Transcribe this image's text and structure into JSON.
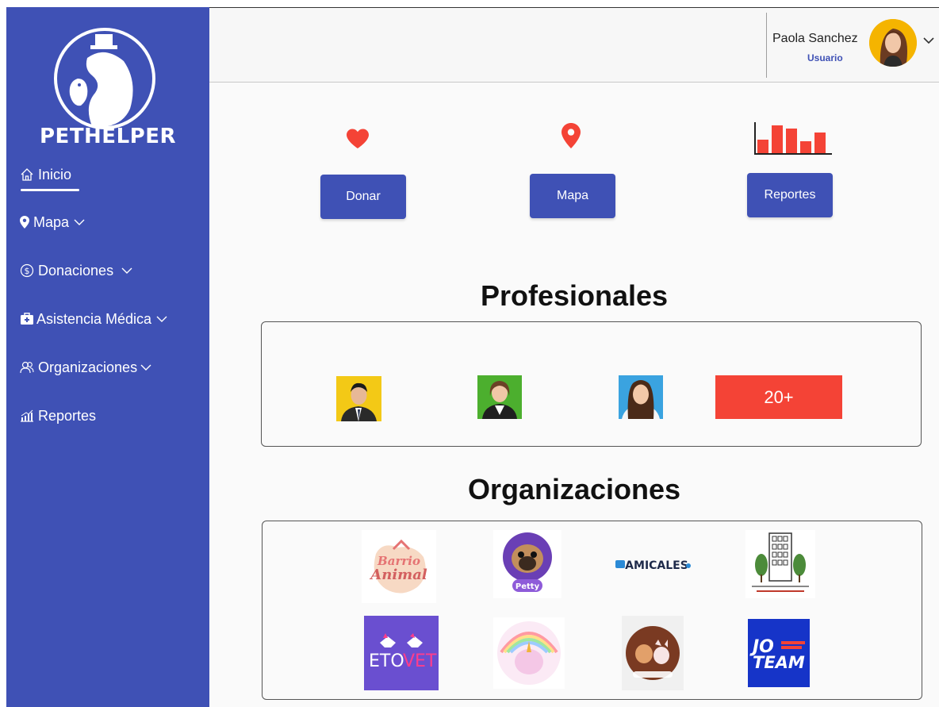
{
  "brand": {
    "name": "PETHELPER"
  },
  "sidebar": {
    "items": [
      {
        "label": "Inicio",
        "icon": "home-icon",
        "has_chevron": false,
        "active": true
      },
      {
        "label": "Mapa",
        "icon": "map-pin-icon",
        "has_chevron": true
      },
      {
        "label": "Donaciones",
        "icon": "coin-icon",
        "has_chevron": true
      },
      {
        "label": "Asistencia Médica",
        "icon": "medical-kit-icon",
        "has_chevron": true
      },
      {
        "label": "Organizaciones",
        "icon": "people-icon",
        "has_chevron": true
      },
      {
        "label": "Reportes",
        "icon": "bar-chart-icon",
        "has_chevron": false
      }
    ]
  },
  "header": {
    "user_name": "Paola Sanchez",
    "user_role": "Usuario"
  },
  "actions": [
    {
      "label": "Donar",
      "icon": "heart-icon"
    },
    {
      "label": "Mapa",
      "icon": "map-pin-icon"
    },
    {
      "label": "Reportes",
      "icon": "bar-chart-icon"
    }
  ],
  "professionals": {
    "title": "Profesionales",
    "more_label": "20+"
  },
  "organizations": {
    "title": "Organizaciones",
    "logos": {
      "amicales": "AMICALES",
      "etovet_a": "ETO",
      "etovet_b": "VET",
      "jo": "JO",
      "team": "TEAM",
      "barrio_a": "Barrio",
      "barrio_b": "Animal",
      "petty": "Petty"
    }
  },
  "colors": {
    "primary": "#3f51b5",
    "accent": "#f44336",
    "avatar_bg": "#f5b400"
  }
}
